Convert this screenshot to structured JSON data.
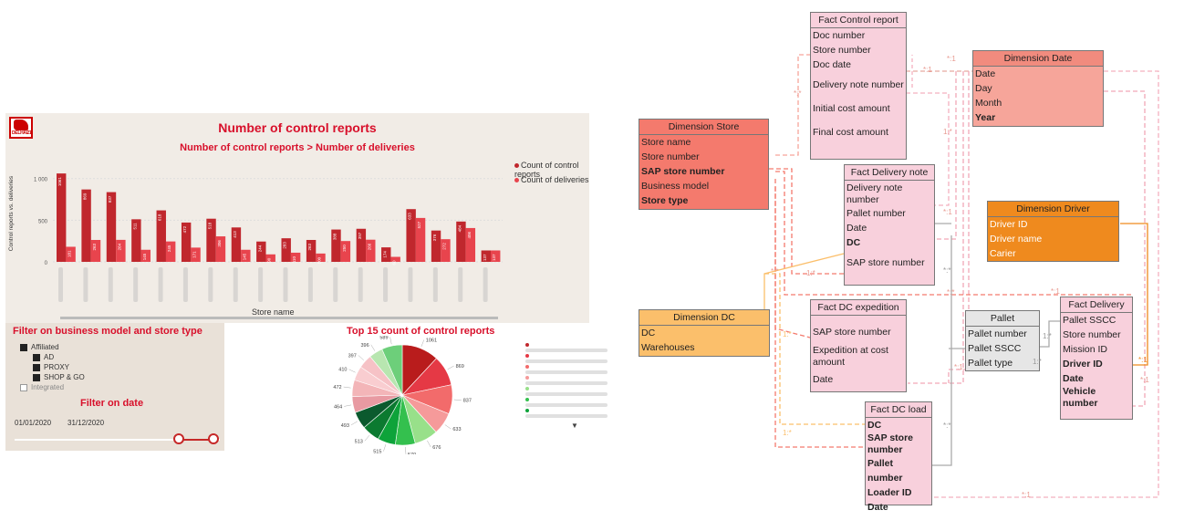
{
  "dashboard": {
    "title": "Number of control reports",
    "subtitle": "Number of control reports > Number of deliveries",
    "logo_text": "DELHAIZE",
    "legend": [
      {
        "label": "Count of control reports",
        "color": "#c0272d"
      },
      {
        "label": "Count of deliveries",
        "color": "#e8444d"
      }
    ],
    "x_title": "Store name",
    "y_title": "Control reports vs. deliveries",
    "filter": {
      "title": "Filter on business model and store type",
      "items": [
        {
          "label": "Affiliated",
          "level": 0,
          "checked": true
        },
        {
          "label": "AD",
          "level": 1,
          "checked": true
        },
        {
          "label": "PROXY",
          "level": 1,
          "checked": true
        },
        {
          "label": "SHOP & GO",
          "level": 1,
          "checked": true
        },
        {
          "label": "Integrated",
          "level": 0,
          "checked": false
        }
      ],
      "date_title": "Filter on date",
      "date_from": "01/01/2020",
      "date_to": "31/12/2020"
    },
    "pie_title": "Top 15 count of control reports"
  },
  "chart_data": [
    {
      "type": "bar",
      "title": "Number of control reports > Number of deliveries",
      "xlabel": "Store name",
      "ylabel": "Control reports vs. deliveries",
      "y_ticks": [
        "1 000",
        "500",
        "0"
      ],
      "ylim": [
        0,
        1150
      ],
      "series": [
        {
          "name": "Count of control reports",
          "color": "#c0272d",
          "values": [
            1061,
            869,
            837,
            511,
            618,
            472,
            518,
            413,
            244,
            283,
            263,
            388,
            397,
            174,
            633,
            376,
            484,
            137
          ]
        },
        {
          "name": "Count of deliveries",
          "color": "#e8444d",
          "values": [
            181,
            263,
            264,
            145,
            245,
            171,
            306,
            145,
            90,
            110,
            100,
            250,
            266,
            60,
            527,
            272,
            406,
            137
          ]
        }
      ]
    },
    {
      "type": "pie",
      "title": "Top 15 count of control reports",
      "values": [
        1061,
        869,
        837,
        633,
        676,
        570,
        515,
        513,
        493,
        464,
        472,
        410,
        397,
        396,
        589
      ],
      "colors": [
        "#b91c1c",
        "#e53945",
        "#f26b6b",
        "#f59a9a",
        "#98e08a",
        "#34c04e",
        "#0ea33a",
        "#0b7a30",
        "#0b5a2e",
        "#e89aa2",
        "#f3b5b8",
        "#f9cdd0",
        "#f6c2c6",
        "#b8e6b0",
        "#6dcf7a"
      ]
    }
  ],
  "erd": {
    "entities": {
      "fact_control_report": {
        "title": "Fact Control report",
        "rows": [
          "Doc number",
          "Store number",
          "Doc date",
          "Delivery note number",
          "Initial cost amount",
          "Final cost amount"
        ]
      },
      "dimension_date": {
        "title": "Dimension Date",
        "rows": [
          "Date",
          "Day",
          "Month",
          "Year"
        ]
      },
      "dimension_store": {
        "title": "Dimension Store",
        "rows": [
          "Store name",
          "Store number",
          "SAP store number",
          "Business model",
          "Store type"
        ]
      },
      "fact_delivery_note": {
        "title": "Fact Delivery note",
        "rows": [
          "Delivery note number",
          "Pallet number",
          "Date",
          "DC",
          "SAP store number"
        ]
      },
      "dimension_driver": {
        "title": "Dimension Driver",
        "rows": [
          "Driver ID",
          "Driver name",
          "Carier"
        ]
      },
      "dimension_dc": {
        "title": "Dimension DC",
        "rows": [
          "DC",
          "Warehouses"
        ]
      },
      "fact_dc_expedition": {
        "title": "Fact DC expedition",
        "rows": [
          "SAP store number",
          "Expedition at cost amount",
          "Date"
        ]
      },
      "pallet": {
        "title": "Pallet",
        "rows": [
          "Pallet number",
          "Pallet SSCC",
          "Pallet type"
        ]
      },
      "fact_delivery": {
        "title": "Fact Delivery",
        "rows": [
          "Pallet SSCC",
          "Store number",
          "Mission ID",
          "Driver ID",
          "Date",
          "Vehicle number"
        ]
      },
      "fact_dc_load": {
        "title": "Fact DC load",
        "rows": [
          "DC",
          "SAP store number",
          "Pallet number",
          "Loader ID",
          "Date"
        ]
      }
    },
    "labels": {
      "r1": "*:1",
      "r2": "*:*",
      "r3": "1:*",
      "r4": "*:1",
      "r5": "1:*",
      "r6": "*:*",
      "r7": "*:1",
      "r8": "*:1",
      "r9": "1:*",
      "r10": "*:*",
      "r11": "*:1",
      "r12": "*:1",
      "r13": "1:*",
      "r14": "*:*",
      "r15": "1:*",
      "r16": "*:1",
      "r17": "*:1",
      "r18": "*:*",
      "r19": "1:*"
    }
  }
}
